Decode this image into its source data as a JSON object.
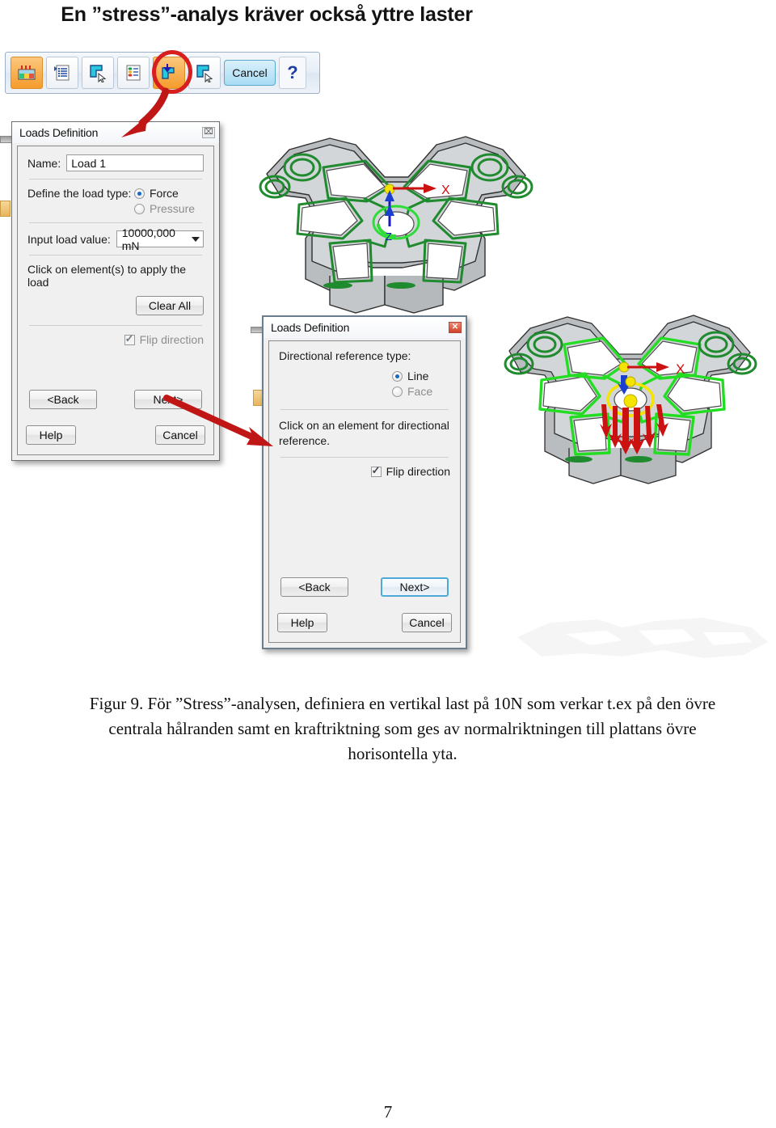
{
  "page": {
    "heading": "En ”stress”-analys kräver också yttre laster",
    "number": "7"
  },
  "toolbar": {
    "buttons": [
      {
        "name": "mesh-results-icon",
        "label": ""
      },
      {
        "name": "list-properties-icon",
        "label": ""
      },
      {
        "name": "select-constraint-icon",
        "label": ""
      },
      {
        "name": "material-list-icon",
        "label": ""
      },
      {
        "name": "add-load-icon",
        "label": ""
      },
      {
        "name": "select-load-icon",
        "label": ""
      }
    ],
    "cancel_label": "Cancel",
    "help_label": "?",
    "highlight_color": "#d81f1f",
    "active_color": "#f59b2c"
  },
  "dialog_one": {
    "title": "Loads Definition",
    "close_label": "⌧",
    "name_label": "Name:",
    "name_value": "Load 1",
    "load_type_label": "Define the load type:",
    "load_type_options": [
      "Force",
      "Pressure"
    ],
    "load_type_selected": "Force",
    "input_value_label": "Input load value:",
    "input_value": "10000,000 mN",
    "instruction": "Click on element(s) to apply the load",
    "clear_all_label": "Clear All",
    "flip_label": "Flip direction",
    "flip_checked": true,
    "back_label": "<Back",
    "next_label": "Next>",
    "help_label": "Help",
    "cancel_label": "Cancel"
  },
  "dialog_two": {
    "title": "Loads Definition",
    "close_label": "✕",
    "ref_type_label": "Directional reference type:",
    "ref_type_options": [
      "Line",
      "Face"
    ],
    "ref_type_selected": "Line",
    "instruction_line1": "Click on an element for directional",
    "instruction_line2": "reference.",
    "flip_label": "Flip direction",
    "flip_checked": true,
    "back_label": "<Back",
    "next_label": "Next>",
    "help_label": "Help",
    "cancel_label": "Cancel"
  },
  "models": {
    "top_view": {
      "name": "cad-part-top-view",
      "axis_labels": [
        "X",
        "Z"
      ],
      "highlight_color": "#1f7a28",
      "force_color": "#cc1111"
    },
    "right_view": {
      "name": "cad-part-loaded-view",
      "axis_labels": [
        "X"
      ],
      "highlight_color": "#22dd22",
      "force_color": "#cc1111",
      "marker_color": "#f5e400"
    }
  },
  "caption": {
    "line1": "Figur 9. För ”Stress”-analysen, definiera en vertikal last på 10N som verkar t.ex på den övre",
    "line2": "centrala hålranden samt en kraftriktning som ges av normalriktningen till  plattans övre",
    "line3": "horisontella yta."
  }
}
